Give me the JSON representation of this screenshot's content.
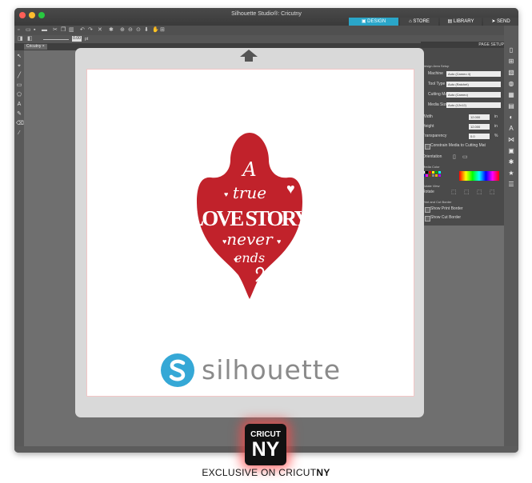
{
  "window": {
    "title": "Silhouette Studio®: Cricutny",
    "tabs": [
      {
        "label": "DESIGN",
        "icon": "design-icon"
      },
      {
        "label": "STORE",
        "icon": "store-icon"
      },
      {
        "label": "LIBRARY",
        "icon": "library-icon"
      },
      {
        "label": "SEND",
        "icon": "send-icon"
      }
    ]
  },
  "toolbar": {
    "zoom_value": "0.00",
    "unit": "pt"
  },
  "document": {
    "tab_label": "Cricutny",
    "close_label": "×"
  },
  "panel": {
    "title": "PAGE SETUP",
    "section_design_area": "Design Area Setup",
    "machine_label": "Machine",
    "machine_value": "Auto (Cameo 4)",
    "tool_type_label": "Tool Type",
    "tool_type_value": "Auto (Ratchet)",
    "cutting_mat_label": "Cutting Mat",
    "cutting_mat_value": "Auto (Cameo)",
    "media_size_label": "Media Size",
    "media_size_value": "Auto (12x12)",
    "width_label": "Width",
    "width_value": "12.000",
    "height_label": "Height",
    "height_value": "12.000",
    "unit_in": "in",
    "transparency_label": "Transparency",
    "transparency_value": "0.0",
    "unit_pct": "%",
    "constrain_label": "Constrain Media to Cutting Mat",
    "orientation_label": "Orientation",
    "media_color_label": "Media Color",
    "rotate_view_label": "Rotate View",
    "rotate_label": "Rotate",
    "print_cut_label": "Print and Cut Border",
    "show_print_border_label": "Show Print Border",
    "show_cut_border_label": "Show Cut Border",
    "swatch_colors": [
      "#ffffff",
      "#000000",
      "#ff0000",
      "#ffff00",
      "#00aa00",
      "#00ffff",
      "#0000ff",
      "#ff00ff",
      "#884400",
      "#888888",
      "#ffaa00",
      "#aa00ff"
    ]
  },
  "artwork": {
    "color": "#c1222b",
    "line1": "A",
    "line2": "true",
    "line3": "LOVE STORY",
    "line4": "never",
    "line5": "ends"
  },
  "brand": {
    "word": "silhouette",
    "color": "#35a8d6"
  },
  "badge": {
    "top": "CRICUT",
    "bottom": "NY"
  },
  "caption": {
    "prefix": "EXCLUSIVE ON CRICUT",
    "suffix": "NY"
  }
}
